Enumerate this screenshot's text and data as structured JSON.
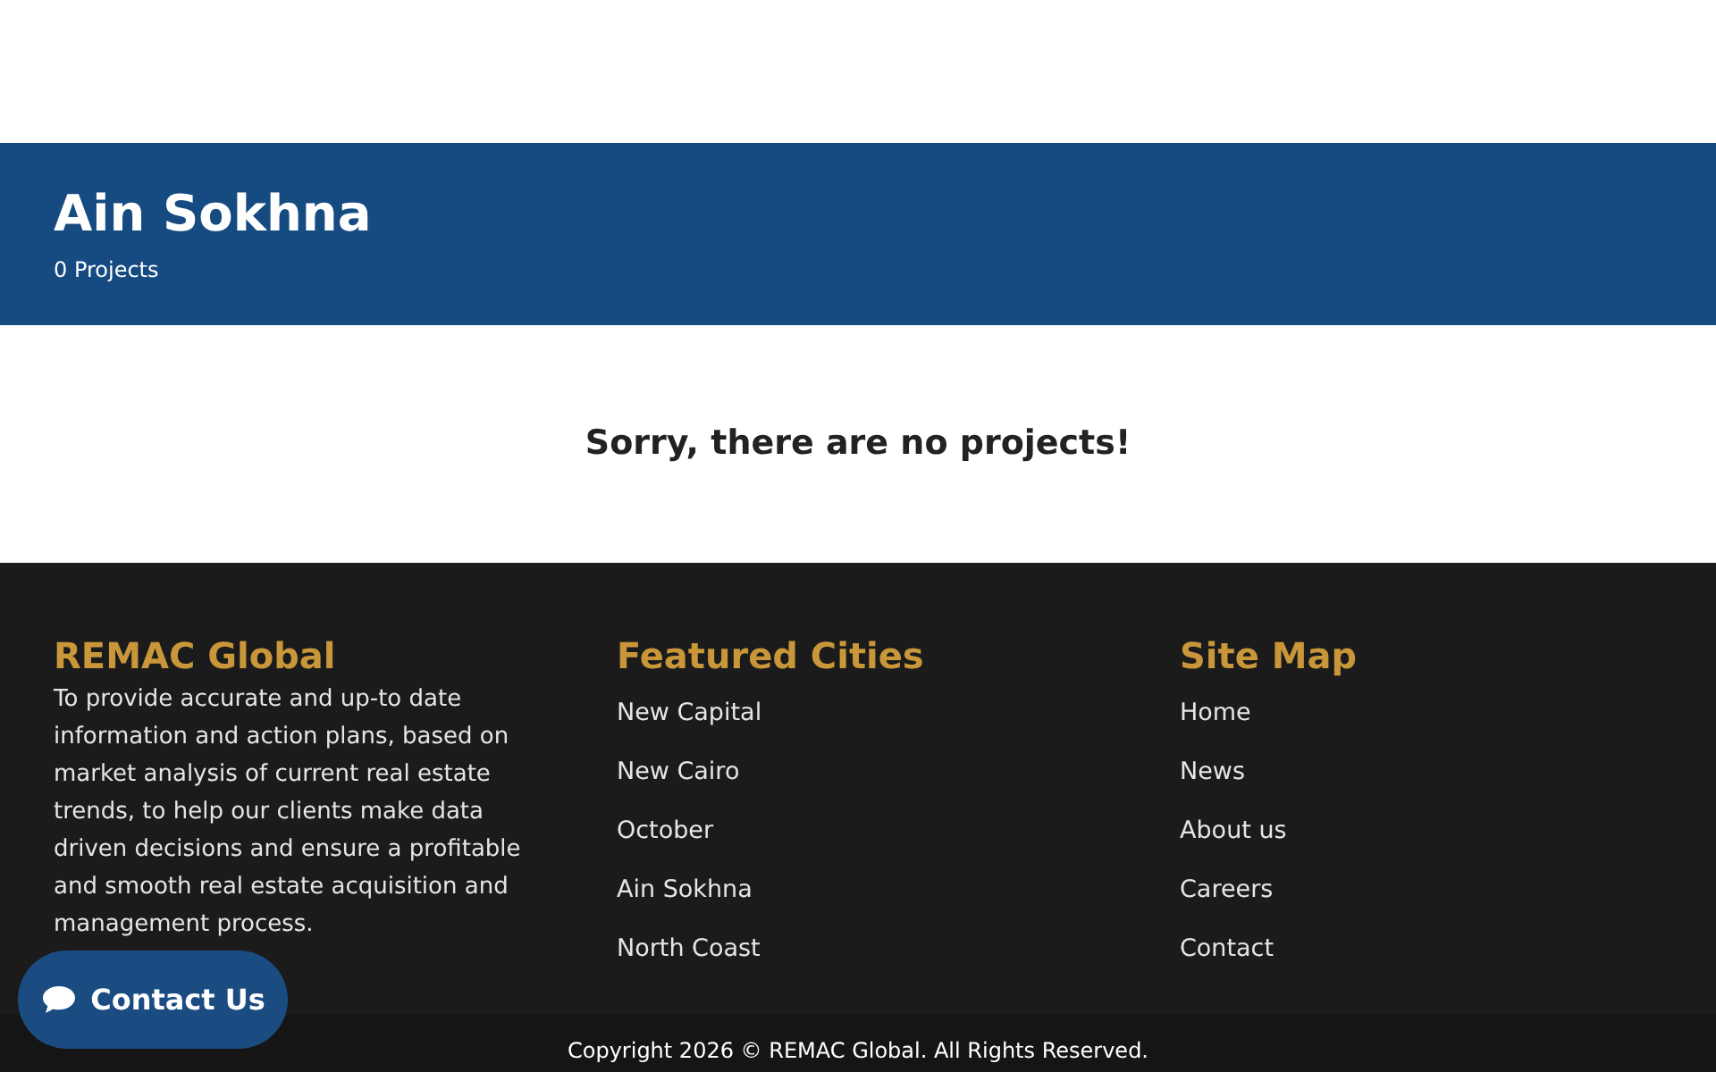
{
  "banner": {
    "title": "Ain Sokhna",
    "subtitle": "0 Projects"
  },
  "message": "Sorry, there are no projects!",
  "footer": {
    "about": {
      "heading": "REMAC Global",
      "text": "To provide accurate and up-to date information and action plans, based on market analysis of current real estate trends, to help our clients make data driven decisions and ensure a profitable and smooth real estate acquisition and management process."
    },
    "cities": {
      "heading": "Featured Cities",
      "links": [
        "New Capital",
        "New Cairo",
        "October",
        "Ain Sokhna",
        "North Coast"
      ]
    },
    "sitemap": {
      "heading": "Site Map",
      "links": [
        "Home",
        "News",
        "About us",
        "Careers",
        "Contact"
      ]
    }
  },
  "contact_button": "Contact Us",
  "copyright": "Copyright 2026 © REMAC Global. All Rights Reserved."
}
